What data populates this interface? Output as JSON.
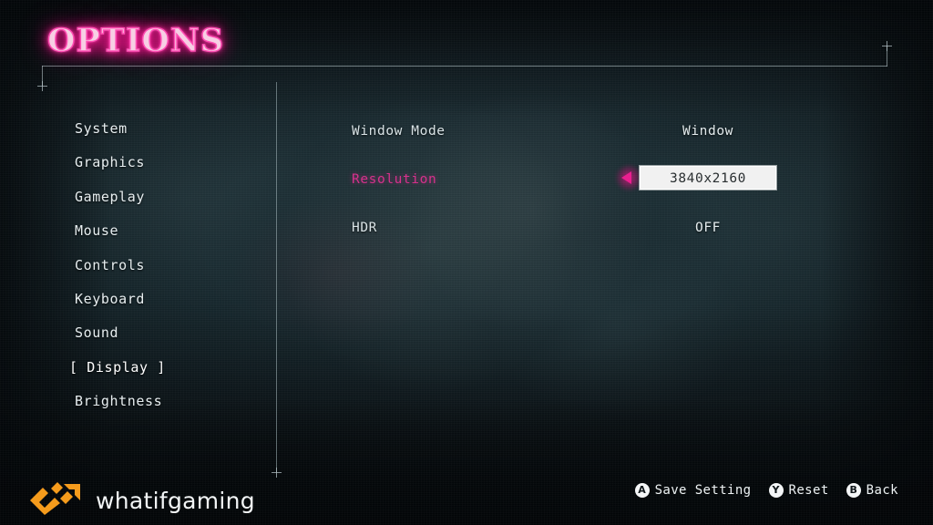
{
  "screen": {
    "title": "OPTIONS",
    "accent_pink": "#ea1f90",
    "title_glow": "#ff1f96",
    "background_color": "#17282e",
    "watermark_orange": "#f59b1c"
  },
  "sidebar": {
    "items": [
      {
        "label": "System",
        "selected": false
      },
      {
        "label": "Graphics",
        "selected": false
      },
      {
        "label": "Gameplay",
        "selected": false
      },
      {
        "label": "Mouse",
        "selected": false
      },
      {
        "label": "Controls",
        "selected": false
      },
      {
        "label": "Keyboard",
        "selected": false
      },
      {
        "label": "Sound",
        "selected": false
      },
      {
        "label": "[ Display ]",
        "selected": true
      },
      {
        "label": "Brightness",
        "selected": false
      }
    ]
  },
  "settings": {
    "rows": [
      {
        "label": "Window Mode",
        "value": "Window",
        "active": false,
        "boxed": false
      },
      {
        "label": "Resolution",
        "value": "3840x2160",
        "active": true,
        "boxed": true
      },
      {
        "label": "HDR",
        "value": "OFF",
        "active": false,
        "boxed": false
      }
    ]
  },
  "watermark": {
    "text": "whatifgaming",
    "logo_icon": "whatifgaming-logo-icon"
  },
  "prompts": [
    {
      "button": "A",
      "label": "Save Setting"
    },
    {
      "button": "Y",
      "label": "Reset"
    },
    {
      "button": "B",
      "label": "Back"
    }
  ]
}
